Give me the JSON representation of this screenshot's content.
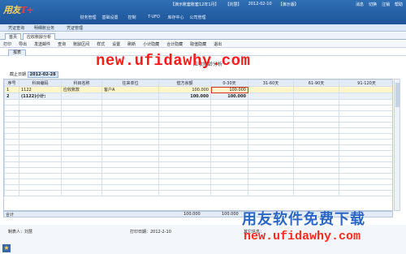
{
  "app": {
    "logo": "用友",
    "logo_suffix": "T+",
    "top_nav": [
      "财务管理",
      "基础设置",
      "控制",
      "T-UFO",
      "库存中心",
      "公司管理"
    ],
    "top_info": [
      "【演示账套账套12年1月】",
      "【刘慧】",
      "2012-02-10",
      "【演示版】"
    ],
    "top_right": [
      "消息",
      "切换",
      "注销",
      "帮助"
    ]
  },
  "subbar": {
    "items": [
      "凭证查询",
      "明细账业务",
      "凭证管理"
    ]
  },
  "tabs": [
    {
      "label": "首页",
      "active": false
    },
    {
      "label": "应收账龄分析",
      "active": true
    }
  ],
  "toolbar": {
    "items": [
      "打印",
      "导出",
      "发送邮件",
      "查询",
      "账龄区间",
      "样式",
      "设置",
      "刷新",
      "小计隐藏",
      "合计隐藏",
      "取值隐藏",
      "退出"
    ]
  },
  "report_tab": "报表",
  "watermark": "new.ufidawhy.com",
  "report_title": "应收账龄分析",
  "cutoff": {
    "label": "截止日期",
    "value": "2012-02-28"
  },
  "grid": {
    "columns": [
      "序号",
      "科目编码",
      "科目名称",
      "往来单位",
      "借方余额",
      "0-30天",
      "31-60天",
      "61-90天",
      "91-120天"
    ],
    "rows": [
      {
        "no": "1",
        "code": "1122",
        "name": "应收账款",
        "party": "客户A",
        "balance": "100.000",
        "d0_30": "100.000",
        "d31_60": "",
        "d61_90": "",
        "d91_120": ""
      },
      {
        "no": "2",
        "code": "(1122)小计:",
        "name": "",
        "party": "",
        "balance": "100.000",
        "d0_30": "100.000",
        "d31_60": "",
        "d61_90": "",
        "d91_120": ""
      }
    ]
  },
  "totals": {
    "label": "合计",
    "balance": "100.000",
    "d0_30": "100.000"
  },
  "footer": {
    "maker": "制表人：刘慧",
    "print_date": "打印日期：2012-2-10",
    "other": "其它信息："
  },
  "brand": {
    "cn": "用友软件免费下载",
    "url": "new.ufidawhy.com"
  }
}
